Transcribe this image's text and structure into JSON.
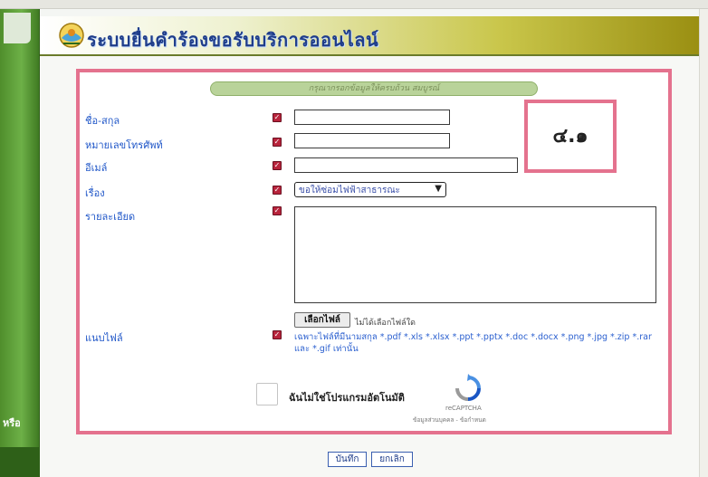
{
  "header": {
    "title": "ระบบยื่นคำร้องขอรับบริการออนไลน์",
    "logo_icon": "organization-seal-icon"
  },
  "sidebar": {
    "partial_label": "หรือ"
  },
  "form": {
    "section_title": "กรุณากรอกข้อมูลให้ครบถ้วน สมบูรณ์",
    "fields": {
      "name_label": "ชื่อ-สกุล",
      "phone_label": "หมายเลขโทรศัพท์",
      "email_label": "อีเมล์",
      "topic_label": "เรื่อง",
      "detail_label": "รายละเอียด",
      "attach_label": "แนบไฟล์"
    },
    "required_mark": "✓",
    "topic_selected": "ขอให้ซ่อมไฟฟ้าสาธารณะ",
    "file_button": "เลือกไฟล์",
    "file_status": "ไม่ได้เลือกไฟล์ใด",
    "file_note": "เฉพาะไฟล์ที่มีนามสกุล *.pdf *.xls *.xlsx *.ppt *.pptx *.doc *.docx *.png *.jpg *.zip *.rar และ *.gif เท่านั้น"
  },
  "captcha": {
    "label": "ฉันไม่ใช่โปรแกรมอัตโนมัติ",
    "brand": "reCAPTCHA",
    "links": "ข้อมูลส่วนบุคคล - ข้อกำหนด"
  },
  "callout": {
    "text": "๔.๑"
  },
  "actions": {
    "save": "บันทึก",
    "cancel": "ยกเลิก"
  },
  "colors": {
    "highlight": "#e4728e",
    "label": "#1f56c8",
    "title": "#1f3d8a",
    "side": "#4f8e2c"
  }
}
